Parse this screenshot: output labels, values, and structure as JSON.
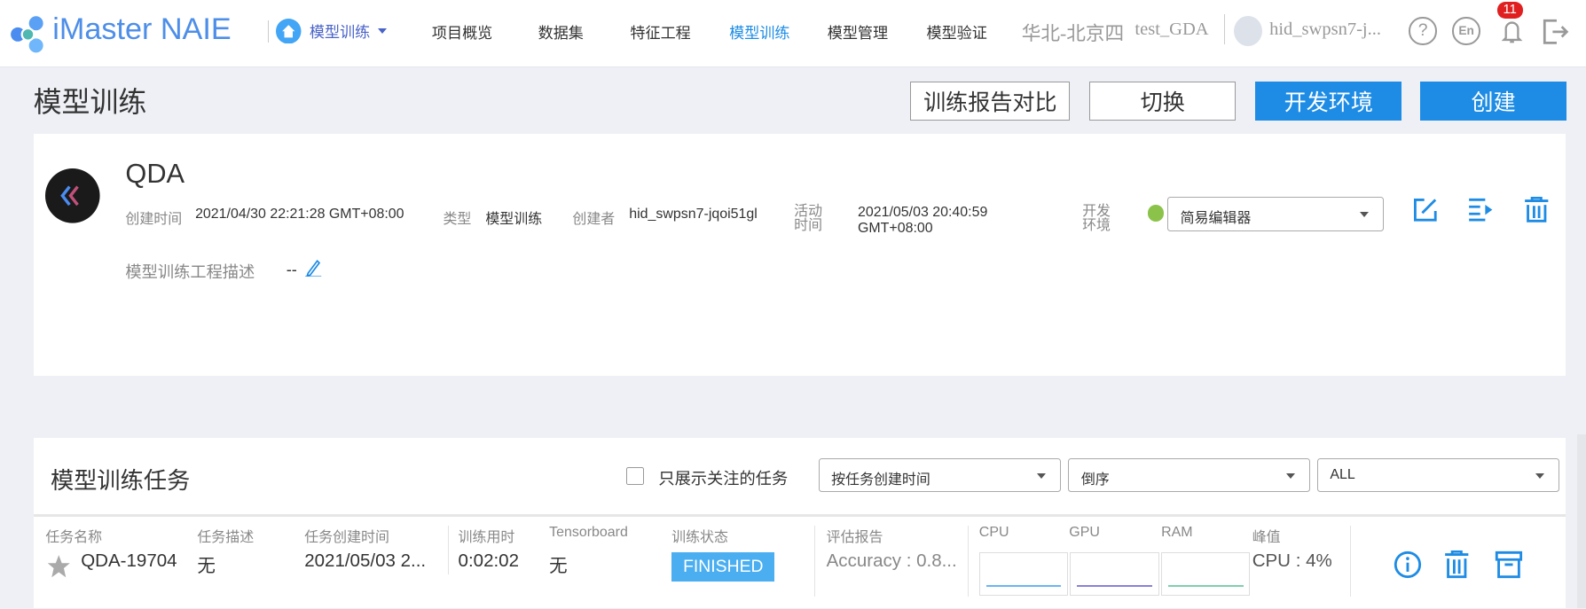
{
  "header": {
    "brand": "iMaster NAIE",
    "module_select": "模型训练",
    "nav": [
      "项目概览",
      "数据集",
      "特征工程",
      "模型训练",
      "模型管理",
      "模型验证"
    ],
    "active_nav": "模型训练",
    "region": "华北-北京四",
    "project": "test_GDA",
    "user": "hid_swpsn7-j...",
    "lang": "En",
    "notification_count": "11"
  },
  "page": {
    "title": "模型训练",
    "buttons": {
      "compare": "训练报告对比",
      "switch": "切换",
      "dev_env": "开发环境",
      "create": "创建"
    }
  },
  "project": {
    "name": "QDA",
    "created_label": "创建时间",
    "created": "2021/04/30 22:21:28 GMT+08:00",
    "type_label": "类型",
    "type": "模型训练",
    "creator_label": "创建者",
    "creator": "hid_swpsn7-jqoi51gl",
    "active_label": "活动时间",
    "active_line1": "2021/05/03 20:40:59",
    "active_line2": "GMT+08:00",
    "env_label": "开发环境",
    "env_value": "简易编辑器",
    "desc_label": "模型训练工程描述",
    "desc": "--"
  },
  "tasks": {
    "title": "模型训练任务",
    "only_starred": "只展示关注的任务",
    "sort_by": "按任务创建时间",
    "order": "倒序",
    "status_filter": "ALL",
    "columns": [
      "任务名称",
      "任务描述",
      "任务创建时间",
      "训练用时",
      "Tensorboard",
      "训练状态",
      "评估报告",
      "CPU",
      "GPU",
      "RAM",
      "峰值"
    ],
    "rows": [
      {
        "name": "QDA-19704",
        "desc": "无",
        "created": "2021/05/03 2...",
        "duration": "0:02:02",
        "tensorboard": "无",
        "status": "FINISHED",
        "report": "Accuracy : 0.8...",
        "peak": "CPU : 4%"
      }
    ]
  },
  "colors": {
    "accent": "#1e8ce4",
    "status_finished": "#4aaef0",
    "env_dot": "#8bc34a"
  }
}
